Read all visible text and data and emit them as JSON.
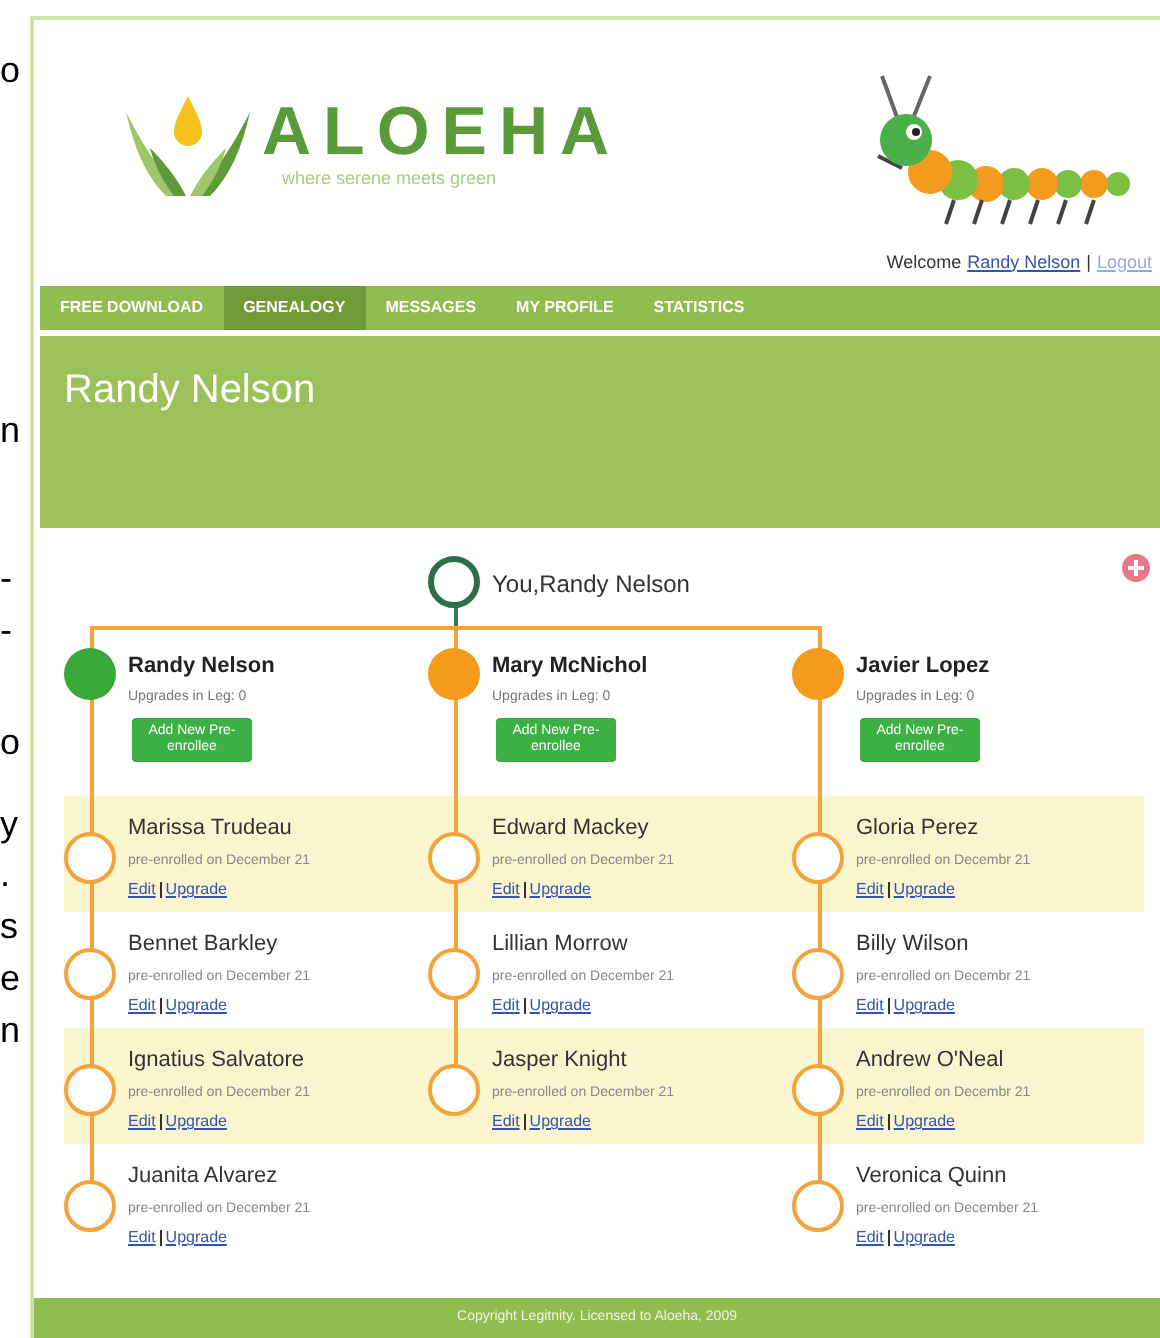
{
  "margin_fragments": [
    "o",
    "n",
    "-",
    "-",
    "o",
    "y",
    ".",
    "s",
    "e",
    "n"
  ],
  "header": {
    "logo": "ALOEHA",
    "tagline": "where serene meets green",
    "welcome": "Welcome",
    "user_link": "Randy Nelson",
    "separator": "|",
    "logout": "Logout"
  },
  "nav": [
    {
      "label": "FREE DOWNLOAD",
      "selected": false
    },
    {
      "label": "GENEALOGY",
      "selected": true
    },
    {
      "label": "MESSAGES",
      "selected": false
    },
    {
      "label": "MY PROFILE",
      "selected": false
    },
    {
      "label": "STATISTICS",
      "selected": false
    }
  ],
  "page_title": "Randy Nelson",
  "tree": {
    "root": "You,Randy Nelson",
    "legs": [
      {
        "name": "Randy Nelson",
        "upgrades": "Upgrades in Leg: 0",
        "button": "Add New Pre-enrollee",
        "color": "#3aa838",
        "members": [
          {
            "name": "Marissa Trudeau",
            "enrolled": "pre-enrolled on December 21",
            "edit": "Edit",
            "upgrade": "Upgrade"
          },
          {
            "name": "Bennet Barkley",
            "enrolled": "pre-enrolled on December 21",
            "edit": "Edit",
            "upgrade": "Upgrade"
          },
          {
            "name": "Ignatius Salvatore",
            "enrolled": "pre-enrolled on December 21",
            "edit": "Edit",
            "upgrade": "Upgrade"
          },
          {
            "name": "Juanita Alvarez",
            "enrolled": "pre-enrolled on December 21",
            "edit": "Edit",
            "upgrade": "Upgrade"
          }
        ]
      },
      {
        "name": "Mary McNichol",
        "upgrades": "Upgrades in Leg: 0",
        "button": "Add New Pre-enrollee",
        "color": "#f59a1c",
        "members": [
          {
            "name": "Edward Mackey",
            "enrolled": "pre-enrolled on December 21",
            "edit": "Edit",
            "upgrade": "Upgrade"
          },
          {
            "name": "Lillian Morrow",
            "enrolled": "pre-enrolled on December 21",
            "edit": "Edit",
            "upgrade": "Upgrade"
          },
          {
            "name": "Jasper Knight",
            "enrolled": "pre-enrolled on December 21",
            "edit": "Edit",
            "upgrade": "Upgrade"
          }
        ]
      },
      {
        "name": "Javier Lopez",
        "upgrades": "Upgrades in Leg: 0",
        "button": "Add New Pre-enrollee",
        "color": "#f59a1c",
        "members": [
          {
            "name": "Gloria Perez",
            "enrolled": "pre-enrolled on Decembr 21",
            "edit": "Edit",
            "upgrade": "Upgrade"
          },
          {
            "name": "Billy Wilson",
            "enrolled": "pre-enrolled on Decembr 21",
            "edit": "Edit",
            "upgrade": "Upgrade"
          },
          {
            "name": "Andrew O'Neal",
            "enrolled": "pre-enrolled on Decembr 21",
            "edit": "Edit",
            "upgrade": "Upgrade"
          },
          {
            "name": "Veronica Quinn",
            "enrolled": "pre-enrolled on December 21",
            "edit": "Edit",
            "upgrade": "Upgrade"
          }
        ]
      }
    ]
  },
  "footer": "Copyright Legitnity. Licensed to Aloeha, 2009"
}
